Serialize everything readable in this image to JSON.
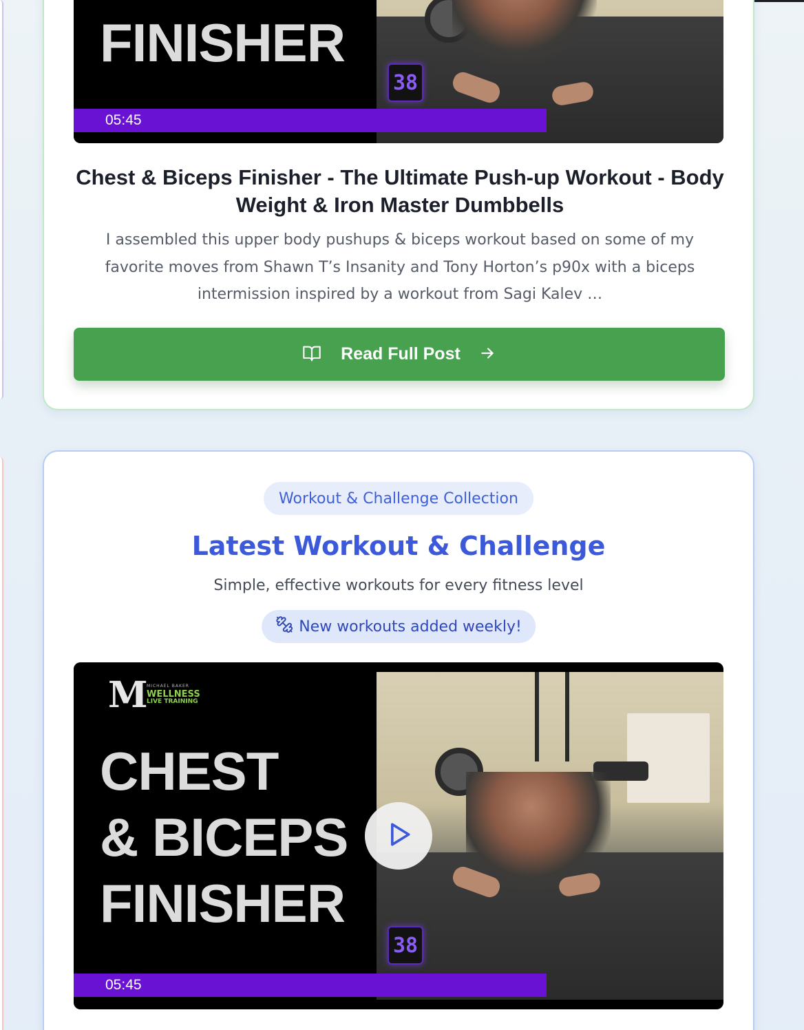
{
  "previous_post": {
    "thumbnail": {
      "title_lines": [
        "FINISHER"
      ],
      "badge": "38",
      "duration": "05:45",
      "progress": 0.73
    },
    "title": "Chest & Biceps Finisher - The Ultimate Push-up Workout - Body Weight & Iron Master Dumbbells",
    "excerpt": "I assembled this upper body pushups & biceps workout based on some of my favorite moves from Shawn T’s Insanity and Tony Horton’s p90x with a biceps intermission inspired by a workout from Sagi Kalev …",
    "button_label": "Read Full Post",
    "button_color": "#47a14e"
  },
  "workout_section": {
    "collection_label": "Workout & Challenge Collection",
    "heading": "Latest Workout & Challenge",
    "subheading": "Simple, effective workouts for every fitness level",
    "weekly_note": "New workouts added weekly!",
    "accent_color": "#3b59d8",
    "video": {
      "logo_letter": "M",
      "logo_small": "MICHAEL BAKER",
      "logo_brand": "WELLNESS",
      "logo_sub": "LIVE TRAINING",
      "title_lines": [
        "CHEST",
        "& BICEPS",
        "FINISHER"
      ],
      "badge": "38",
      "duration": "05:45",
      "progress": 0.73
    }
  },
  "icons": {
    "read_button_left": "book-open-icon",
    "read_button_right": "arrow-right-icon",
    "weekly_note": "dumbbell-icon",
    "video": "play-icon"
  }
}
